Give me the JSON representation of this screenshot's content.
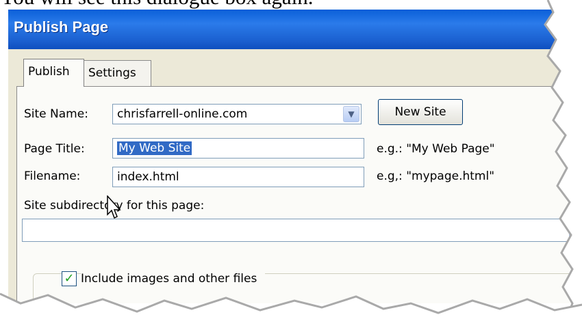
{
  "caption": "You will see this dialogue box again.",
  "dialog": {
    "title": "Publish Page",
    "tabs": [
      {
        "label": "Publish",
        "active": true
      },
      {
        "label": "Settings",
        "active": false
      }
    ]
  },
  "publish_tab": {
    "site_name_label": "Site Name:",
    "site_name_value": "chrisfarrell-online.com",
    "new_site_label": "New Site",
    "page_title_label": "Page Title:",
    "page_title_value": "My Web Site",
    "page_title_hint": "e.g.: \"My Web Page\"",
    "filename_label": "Filename:",
    "filename_value": "index.html",
    "filename_hint": "e.g,: \"mypage.html\"",
    "subdirectory_label": "Site subdirectory for this page:",
    "subdirectory_value": "",
    "include_images_label": "Include images and other files",
    "include_images_checked": true
  },
  "colors": {
    "titlebar": "#2b7bea",
    "selection": "#316ac5",
    "checkmark": "#21a121"
  }
}
